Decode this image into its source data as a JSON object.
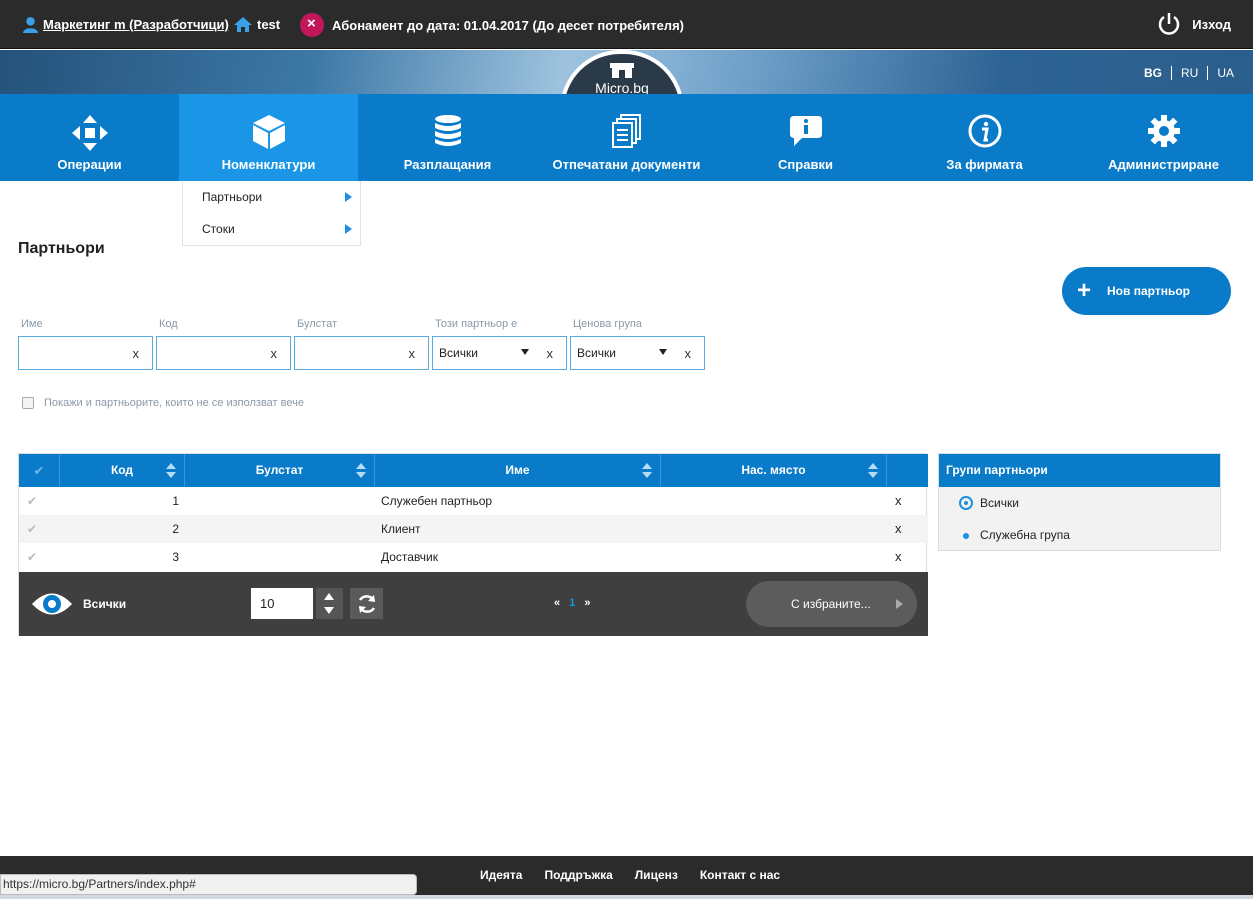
{
  "topbar": {
    "user_label": "Маркетинг m (Разработчици)",
    "company": "test",
    "subscription_prefix": "Абонамент до дата:",
    "subscription_value": "01.04.2017 (До десет потребителя)",
    "logout": "Изход"
  },
  "banner": {
    "logo_text": "Micro.bg",
    "languages": [
      "BG",
      "RU",
      "UA"
    ]
  },
  "nav": {
    "items": [
      {
        "label": "Операции",
        "icon": "arrows-move-icon"
      },
      {
        "label": "Номенклатури",
        "icon": "cube-icon"
      },
      {
        "label": "Разплащания",
        "icon": "coins-stack-icon"
      },
      {
        "label": "Отпечатани документи",
        "icon": "documents-icon"
      },
      {
        "label": "Справки",
        "icon": "speech-info-icon"
      },
      {
        "label": "За фирмата",
        "icon": "info-circle-icon"
      },
      {
        "label": "Администриране",
        "icon": "gear-icon"
      }
    ],
    "active": "Номенклатури",
    "dropdown": [
      "Партньори",
      "Стоки"
    ]
  },
  "page": {
    "title": "Партньори",
    "new_button": "Нов партньор"
  },
  "filters": {
    "name_label": "Име",
    "code_label": "Код",
    "bulstat_label": "Булстат",
    "type_label": "Този партньор е",
    "type_value": "Всички",
    "price_group_label": "Ценова група",
    "price_group_value": "Всички",
    "clear": "x",
    "show_unused": "Покажи и партньорите, които не се използват вече"
  },
  "table": {
    "columns": [
      "Код",
      "Булстат",
      "Име",
      "Нас. място"
    ],
    "rows": [
      {
        "code": "1",
        "bulstat": "",
        "name": "Служебен партньор",
        "place": ""
      },
      {
        "code": "2",
        "bulstat": "",
        "name": "Клиент",
        "place": ""
      },
      {
        "code": "3",
        "bulstat": "",
        "name": "Доставчик",
        "place": ""
      }
    ],
    "delete_glyph": "x",
    "check_glyph": "✔",
    "footer": {
      "show_label": "Всички",
      "page_size": "10",
      "prev": "«",
      "current_page": "1",
      "next": "»",
      "selected_action": "С избраните..."
    }
  },
  "groups": {
    "title": "Групи партньори",
    "items": [
      "Всички",
      "Служебна група"
    ],
    "selected": "Всички"
  },
  "footer": {
    "links": [
      "Идеята",
      "Поддръжка",
      "Лиценз",
      "Контакт с нас"
    ],
    "status_url": "https://micro.bg/Partners/index.php#"
  },
  "colors": {
    "brand_blue": "#0a7bc9",
    "active_nav": "#1b96e6",
    "dark_bar": "#2b2b2b",
    "badge": "#c2185b"
  }
}
